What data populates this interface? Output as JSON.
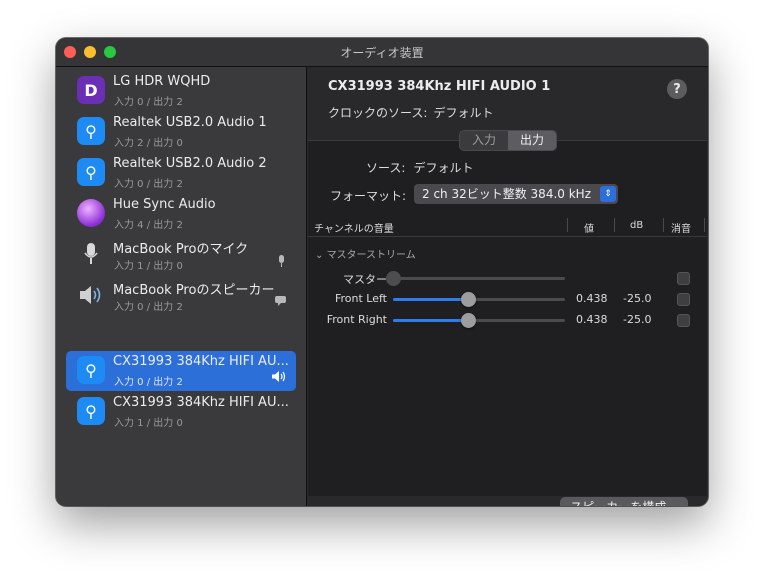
{
  "window": {
    "title": "オーディオ装置"
  },
  "devices": [
    {
      "name": "LG HDR WQHD",
      "io": "入力 0 / 出力 2",
      "icon": "displayport-icon",
      "selected": false
    },
    {
      "name": "Realtek USB2.0 Audio 1",
      "io": "入力 2 / 出力 0",
      "icon": "usb-icon",
      "selected": false
    },
    {
      "name": "Realtek USB2.0 Audio 2",
      "io": "入力 0 / 出力 2",
      "icon": "usb-icon",
      "selected": false
    },
    {
      "name": "Hue Sync Audio",
      "io": "入力 4 / 出力 2",
      "icon": "hue-bulb-icon",
      "selected": false
    },
    {
      "name": "MacBook Proのマイク",
      "io": "入力 1 / 出力 0",
      "icon": "microphone-icon",
      "selected": false
    },
    {
      "name": "MacBook Proのスピーカー",
      "io": "入力 0 / 出力 2",
      "icon": "speaker-icon",
      "selected": false
    },
    {
      "name": "CX31993 384Khz HIFI AU...",
      "io": "入力 0 / 出力 2",
      "icon": "usb-icon",
      "selected": true
    },
    {
      "name": "CX31993 384Khz HIFI AU...",
      "io": "入力 1 / 出力 0",
      "icon": "usb-icon",
      "selected": false
    }
  ],
  "toolbar": {
    "add": "+",
    "remove": "−",
    "gear": "⚙",
    "chevron": "⌄"
  },
  "detail": {
    "title": "CX31993 384Khz HIFI AUDIO 1",
    "help": "?",
    "clock_label": "クロックのソース:",
    "clock_value": "デフォルト",
    "tabs": [
      {
        "label": "入力",
        "active": false
      },
      {
        "label": "出力",
        "active": true
      }
    ],
    "source_label": "ソース:",
    "source_value": "デフォルト",
    "format_label": "フォーマット:",
    "format_value": "2 ch 32ビット整数 384.0 kHz",
    "columns": {
      "channel": "チャンネルの音量",
      "value": "値",
      "db": "dB",
      "mute": "消音"
    },
    "group": "マスターストリーム",
    "channels": [
      {
        "label": "マスター",
        "level": 0.0,
        "value": "",
        "db": "",
        "enabled": false
      },
      {
        "label": "Front Left",
        "level": 0.438,
        "value": "0.438",
        "db": "-25.0",
        "enabled": true
      },
      {
        "label": "Front Right",
        "level": 0.438,
        "value": "0.438",
        "db": "-25.0",
        "enabled": true
      }
    ],
    "configure_button": "スピーカーを構成..."
  },
  "colors": {
    "accent": "#2d6fd8",
    "selection": "#2d6fd8"
  }
}
